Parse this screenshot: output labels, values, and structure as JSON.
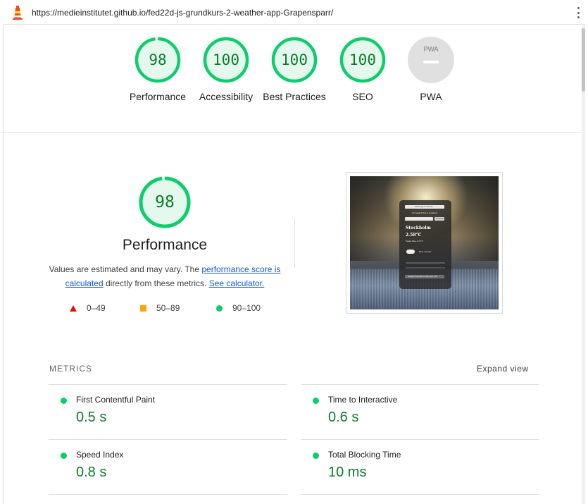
{
  "browser": {
    "url": "https://medieinstitutet.github.io/fed22d-js-grundkurs-2-weather-app-Grapensparr/"
  },
  "gauges": [
    {
      "label": "Performance",
      "score": "98"
    },
    {
      "label": "Accessibility",
      "score": "100"
    },
    {
      "label": "Best Practices",
      "score": "100"
    },
    {
      "label": "SEO",
      "score": "100"
    },
    {
      "label": "PWA",
      "badge": "PWA"
    }
  ],
  "performance": {
    "score": "98",
    "title": "Performance",
    "desc_prefix": "Values are estimated and may vary. The ",
    "link_score": "performance score is calculated",
    "desc_middle": " directly from these metrics. ",
    "link_calc": "See calculator."
  },
  "legend": {
    "fail": "0–49",
    "average": "50–89",
    "pass": "90–100"
  },
  "thumbnail": {
    "search_bar": "Find my location",
    "subtitle": "Or search for a location",
    "button": "Search",
    "city": "Stockholm",
    "temp": "2.58°C",
    "feels": "Feels like -0.8°C",
    "condition": "Few clouds",
    "footer": "Display forecast for the next 12h"
  },
  "metrics": {
    "header": "METRICS",
    "expand_label": "Expand view",
    "items": [
      {
        "title": "First Contentful Paint",
        "value": "0.5 s"
      },
      {
        "title": "Time to Interactive",
        "value": "0.6 s"
      },
      {
        "title": "Speed Index",
        "value": "0.8 s"
      },
      {
        "title": "Total Blocking Time",
        "value": "10 ms"
      }
    ]
  },
  "colors": {
    "pass": "#0cce6b",
    "pass_text": "#0c7d2c",
    "average": "#ffa400",
    "fail": "#eb0f00",
    "link": "#1558d6"
  }
}
